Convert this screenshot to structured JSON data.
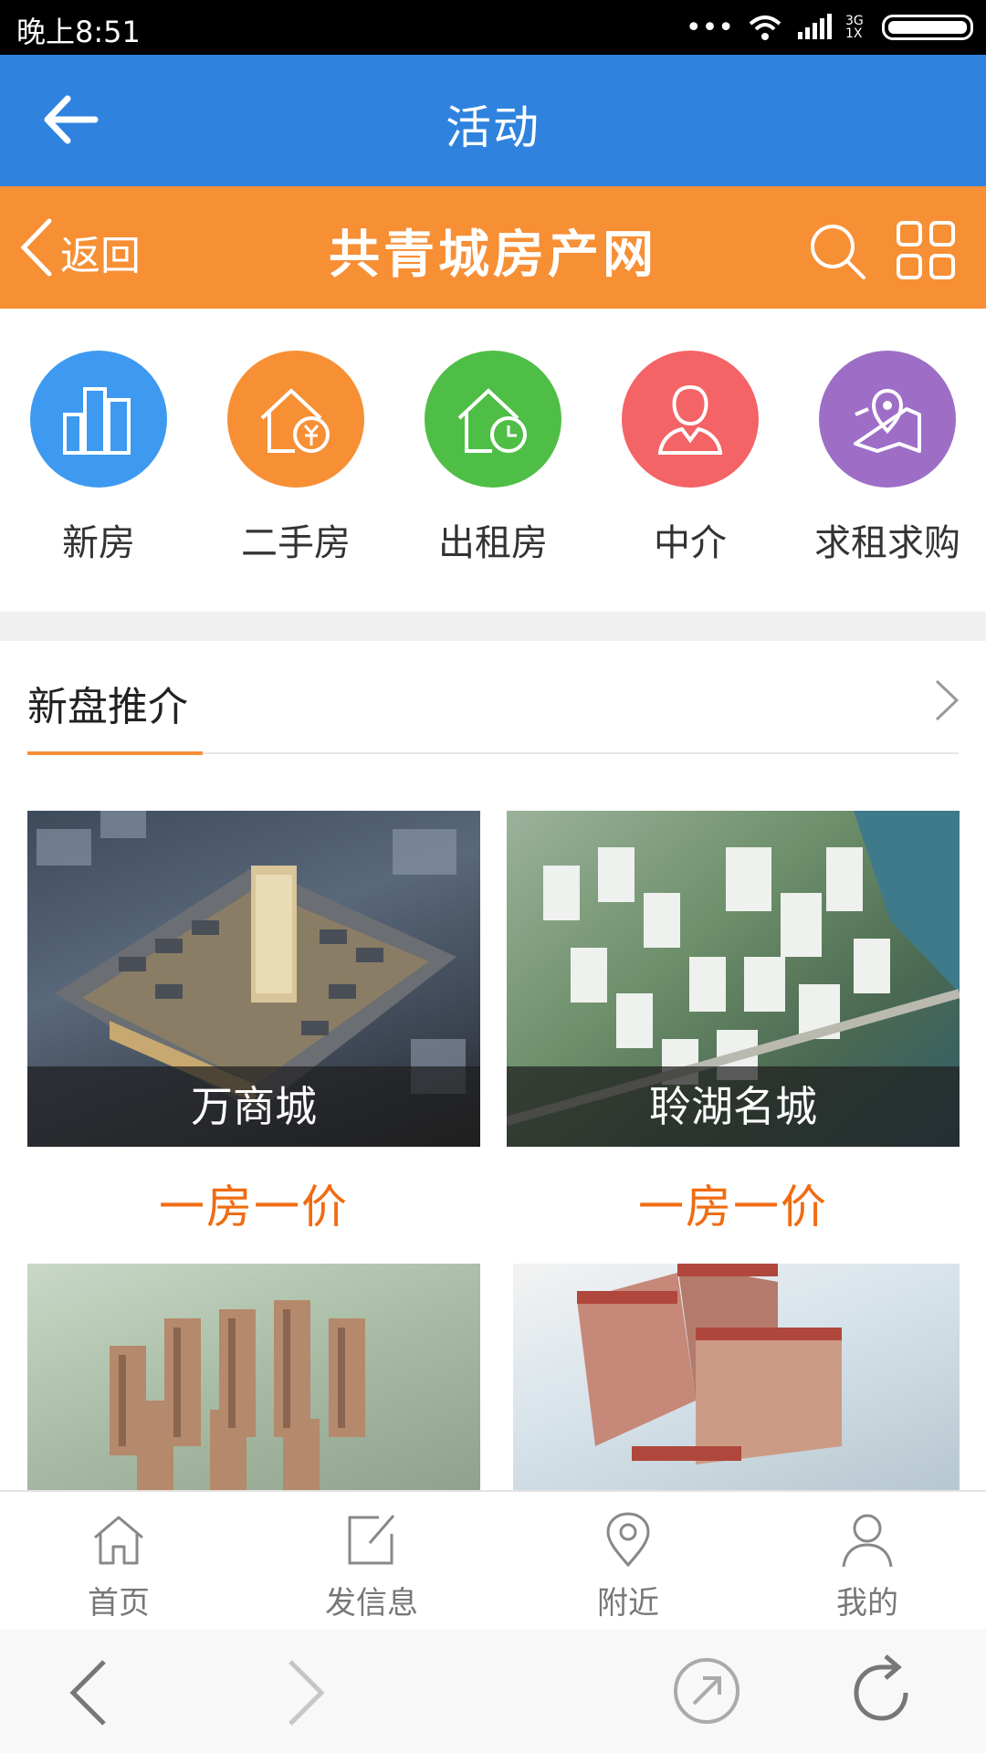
{
  "status_bar": {
    "time": "晚上8:51",
    "network": "3G 1X"
  },
  "app_bar": {
    "title": "活动",
    "back_icon": "arrow-left-icon"
  },
  "site_header": {
    "back_label": "返回",
    "title": "共青城房产网",
    "search_icon": "search-icon",
    "menu_icon": "grid-icon"
  },
  "categories": [
    {
      "label": "新房",
      "icon": "buildings-icon",
      "color": "#3d9af0"
    },
    {
      "label": "二手房",
      "icon": "house-yen-icon",
      "color": "#f78f35"
    },
    {
      "label": "出租房",
      "icon": "house-clock-icon",
      "color": "#4fbe46"
    },
    {
      "label": "中介",
      "icon": "agent-icon",
      "color": "#f46365"
    },
    {
      "label": "求租求购",
      "icon": "map-pin-icon",
      "color": "#9e6ec7"
    }
  ],
  "section": {
    "title": "新盘推介"
  },
  "properties": [
    {
      "name": "万商城",
      "price": "一房一价"
    },
    {
      "name": "聆湖名城",
      "price": "一房一价"
    }
  ],
  "tabs": [
    {
      "label": "首页",
      "icon": "home-icon"
    },
    {
      "label": "发信息",
      "icon": "edit-icon"
    },
    {
      "label": "附近",
      "icon": "location-icon"
    },
    {
      "label": "我的",
      "icon": "user-icon"
    }
  ],
  "colors": {
    "app_bar": "#2f83de",
    "site_header": "#f78f35",
    "price": "#f06c13"
  }
}
